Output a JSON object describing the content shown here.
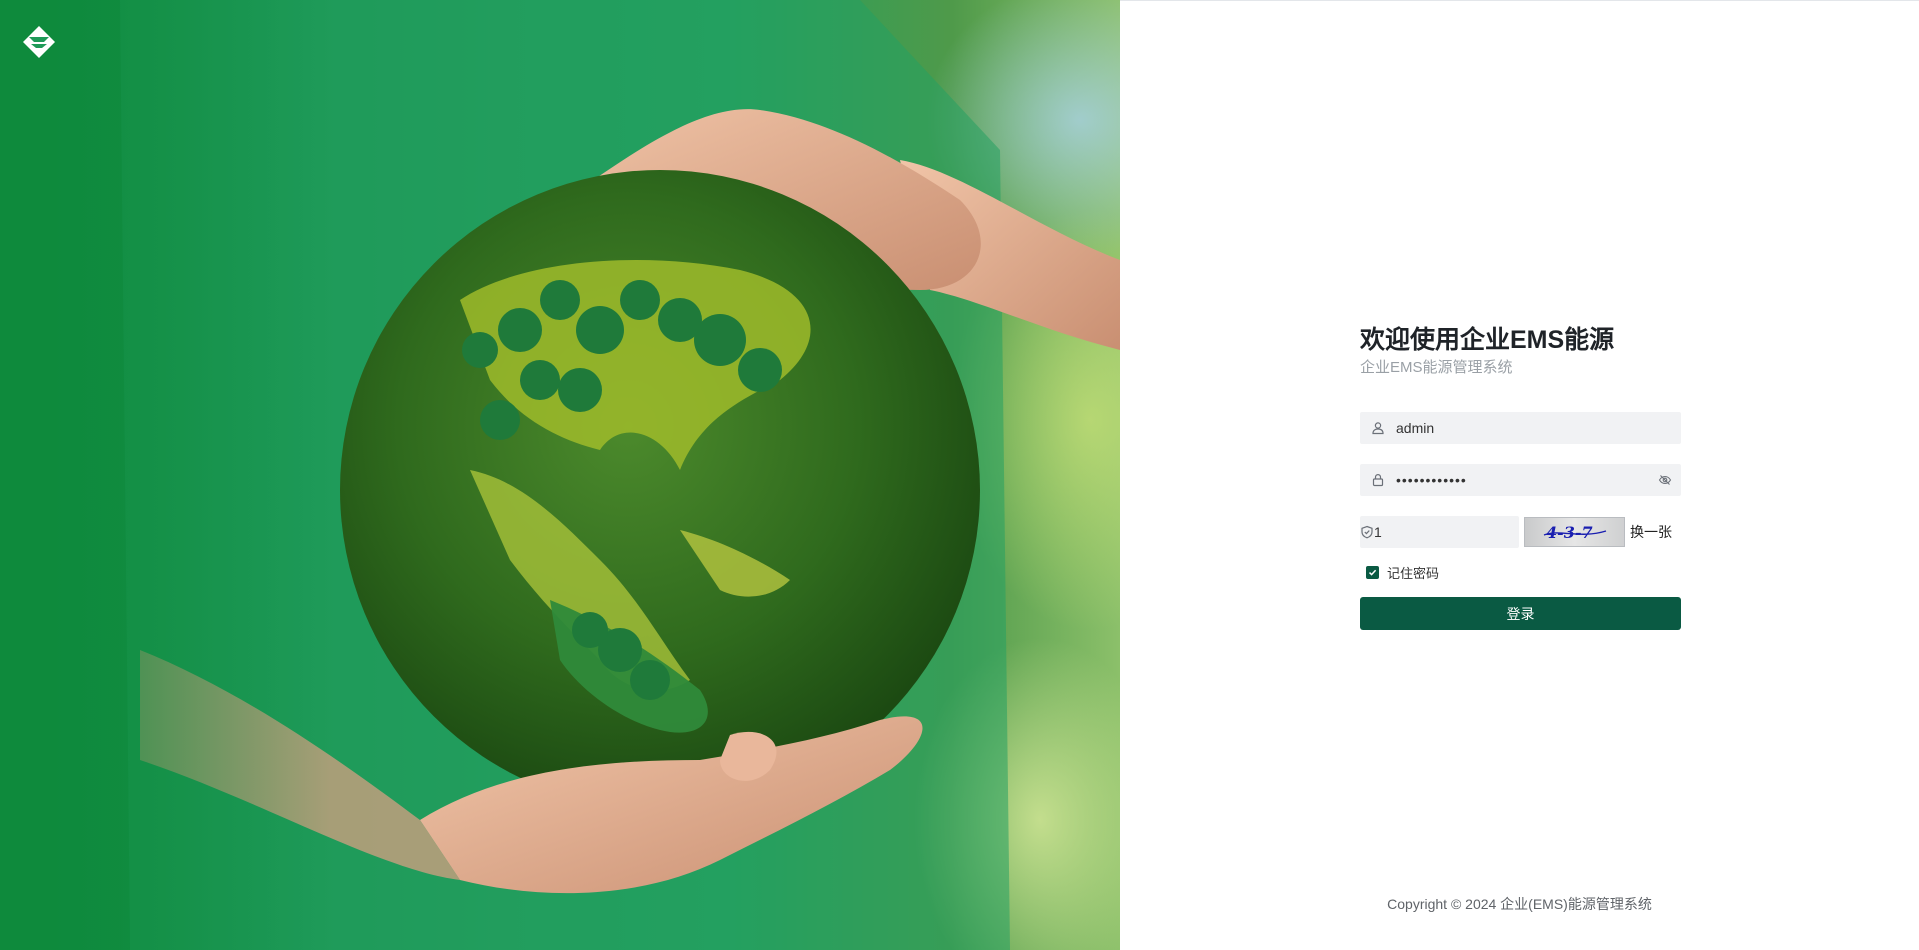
{
  "brand": {
    "logo_icon": "diamond-logo-icon"
  },
  "colors": {
    "primary": "#0a5a43",
    "hero_green": "#1f9a58",
    "field_bg": "#f1f2f4"
  },
  "login": {
    "title": "欢迎使用企业EMS能源",
    "subtitle": "企业EMS能源管理系统",
    "username": {
      "value": "admin",
      "icon": "user-icon"
    },
    "password": {
      "value": "••••••••••••",
      "icon": "lock-icon",
      "toggle_icon": "eye-off-icon"
    },
    "captcha": {
      "value": "1",
      "icon": "shield-icon",
      "image_text": "4-3-7",
      "refresh_label": "换一张"
    },
    "remember": {
      "label": "记住密码",
      "checked": true
    },
    "submit_label": "登录"
  },
  "footer": {
    "copyright": "Copyright © 2024 企业(EMS)能源管理系统"
  }
}
